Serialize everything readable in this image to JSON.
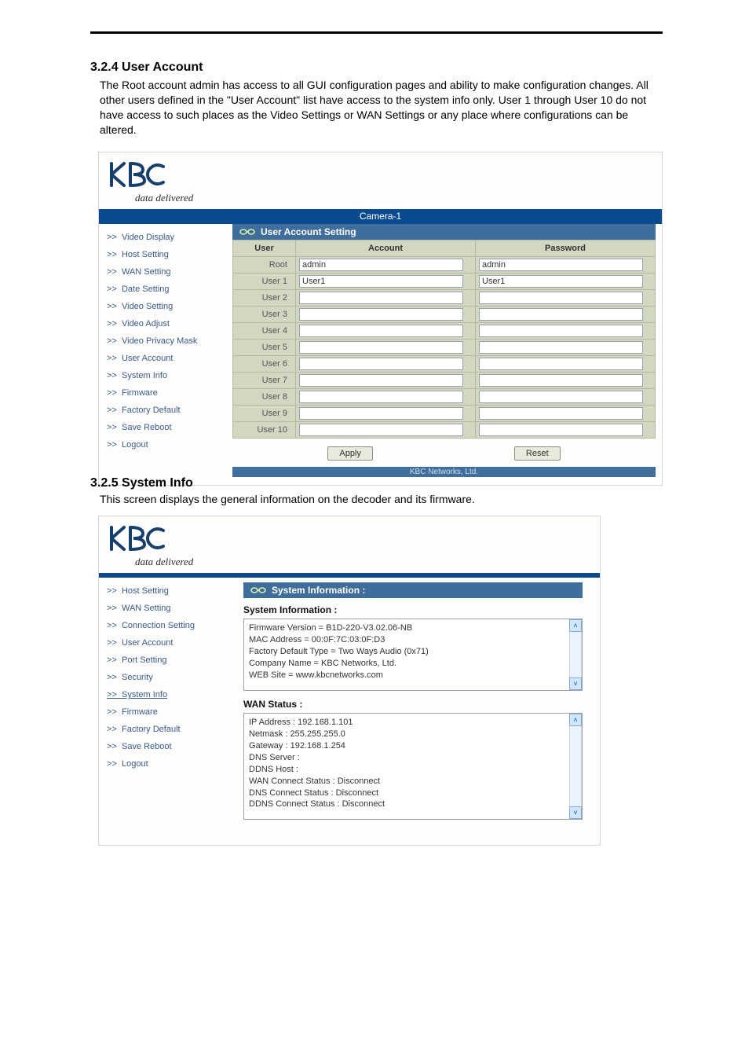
{
  "doc": {
    "h1": "3.2.4 User Account",
    "p1": "The Root account admin has access to all GUI configuration pages and ability to make configuration changes. All other users defined in the \"User Account\" list have access to the system info only. User 1 through User 10 do not have access to such places as the Video Settings or WAN Settings or any place where configurations can be altered.",
    "h2": "3.2.5 System Info",
    "p2": "This screen displays the general information on the decoder and its firmware."
  },
  "brand": {
    "tagline": "data delivered"
  },
  "panel1": {
    "camera_title": "Camera-1",
    "section_title": "User Account Setting",
    "footer": "KBC Networks, Ltd.",
    "sidebar": [
      "Video Display",
      "Host Setting",
      "WAN Setting",
      "Date Setting",
      "Video Setting",
      "Video Adjust",
      "Video Privacy Mask",
      "User Account",
      "System Info",
      "Firmware",
      "Factory Default",
      "Save Reboot",
      "Logout"
    ],
    "headers": {
      "user": "User",
      "account": "Account",
      "password": "Password"
    },
    "rows": [
      {
        "user": "Root",
        "account": "admin",
        "password": "admin"
      },
      {
        "user": "User 1",
        "account": "User1",
        "password": "User1"
      },
      {
        "user": "User 2",
        "account": "",
        "password": ""
      },
      {
        "user": "User 3",
        "account": "",
        "password": ""
      },
      {
        "user": "User 4",
        "account": "",
        "password": ""
      },
      {
        "user": "User 5",
        "account": "",
        "password": ""
      },
      {
        "user": "User 6",
        "account": "",
        "password": ""
      },
      {
        "user": "User 7",
        "account": "",
        "password": ""
      },
      {
        "user": "User 8",
        "account": "",
        "password": ""
      },
      {
        "user": "User 9",
        "account": "",
        "password": ""
      },
      {
        "user": "User 10",
        "account": "",
        "password": ""
      }
    ],
    "buttons": {
      "apply": "Apply",
      "reset": "Reset"
    }
  },
  "panel2": {
    "section_title": "System Information :",
    "sidebar": [
      "Host Setting",
      "WAN Setting",
      "Connection Setting",
      "User Account",
      "Port Setting",
      "Security",
      "System Info",
      "Firmware",
      "Factory Default",
      "Save Reboot",
      "Logout"
    ],
    "sysinfo_head": "System Information :",
    "sysinfo_lines": [
      "Firmware Version = B1D-220-V3.02.06-NB",
      "MAC Address = 00:0F:7C:03:0F:D3",
      "Factory Default Type = Two Ways Audio (0x71)",
      "Company Name = KBC Networks, Ltd.",
      "WEB Site =  www.kbcnetworks.com"
    ],
    "wan_head": "WAN Status :",
    "wan_lines": [
      "IP Address : 192.168.1.101",
      "Netmask : 255.255.255.0",
      "Gateway : 192.168.1.254",
      "DNS Server :",
      "DDNS Host :",
      "WAN Connect Status : Disconnect",
      "DNS Connect Status : Disconnect",
      "DDNS Connect Status : Disconnect"
    ]
  }
}
